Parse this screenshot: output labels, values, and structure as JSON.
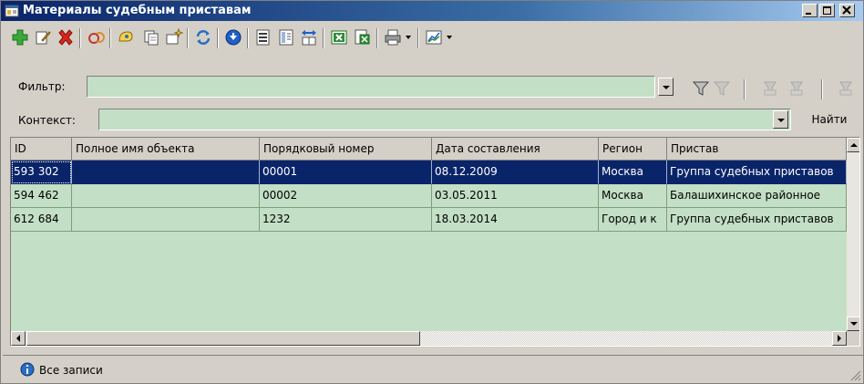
{
  "window": {
    "title": "Материалы судебным приставам",
    "app_icon": "app-window-icon",
    "controls": [
      "minimize-icon",
      "maximize-icon",
      "close-icon"
    ]
  },
  "toolbar": {
    "buttons": [
      {
        "name": "add-icon"
      },
      {
        "name": "edit-icon"
      },
      {
        "name": "delete-icon"
      },
      {
        "name": "link-icon"
      },
      {
        "name": "properties-icon"
      },
      {
        "name": "copy-icon"
      },
      {
        "name": "new-window-icon"
      },
      {
        "name": "refresh-icon"
      },
      {
        "name": "down-arrow-icon"
      },
      {
        "name": "list-view-icon"
      },
      {
        "name": "column-view-icon"
      },
      {
        "name": "fit-columns-icon"
      },
      {
        "name": "excel-icon"
      },
      {
        "name": "export-icon"
      },
      {
        "name": "print-icon"
      },
      {
        "name": "chart-icon"
      }
    ]
  },
  "filter": {
    "label": "Фильтр:",
    "value": "",
    "icons": [
      "filter-icon",
      "filter-edit-icon",
      "filter-add-icon",
      "filter-remove-icon",
      "filter-clear-icon"
    ]
  },
  "context": {
    "label": "Контекст:",
    "value": "",
    "find_label": "Найти"
  },
  "grid": {
    "columns": [
      "ID",
      "Полное имя объекта",
      "Порядковый номер",
      "Дата составления",
      "Регион",
      "Пристав"
    ],
    "rows": [
      {
        "id": "593 302",
        "full_name": "",
        "number": "00001",
        "date": "08.12.2009",
        "region": "Москва",
        "bailiff": "Группа судебных приставов",
        "selected": true
      },
      {
        "id": "594 462",
        "full_name": "",
        "number": "00002",
        "date": "03.05.2011",
        "region": "Москва",
        "bailiff": "Балашихинское районное",
        "selected": false
      },
      {
        "id": "612 684",
        "full_name": "",
        "number": "1232",
        "date": "18.03.2014",
        "region": "Город и к",
        "bailiff": "Группа судебных приставов",
        "selected": false
      }
    ]
  },
  "status": {
    "icon": "info-icon",
    "text": "Все записи"
  },
  "colors": {
    "title_bar": "#0a246a",
    "grid_bg": "#c3dfc5",
    "selection": "#0a246a",
    "face": "#d4d0c8"
  }
}
